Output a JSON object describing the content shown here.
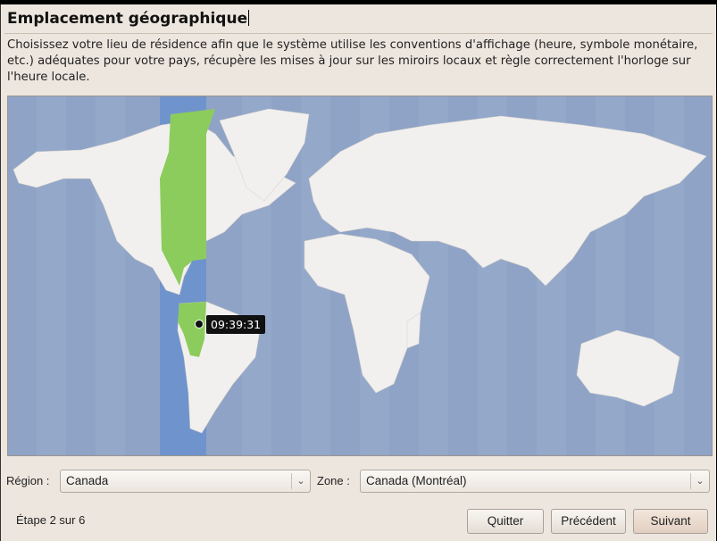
{
  "header": {
    "title": "Emplacement géographique"
  },
  "description": "Choisissez votre lieu de résidence afin que le système utilise les conventions d'affichage (heure, symbole monétaire, etc.) adéquates pour votre pays, récupère les mises à jour sur les miroirs locaux et règle correctement l'horloge sur l'heure locale.",
  "map": {
    "selected_time": "09:39:31",
    "colors": {
      "ocean": "#8fa3c6",
      "land": "#f2f0ee",
      "zone_band": "#6f93cc",
      "zone_land": "#8ccc5c"
    }
  },
  "region": {
    "label": "Région :",
    "value": "Canada"
  },
  "zone": {
    "label": "Zone :",
    "value": "Canada (Montréal)"
  },
  "footer": {
    "step": "Étape 2 sur 6",
    "quit": "Quitter",
    "previous": "Précédent",
    "next": "Suivant"
  }
}
